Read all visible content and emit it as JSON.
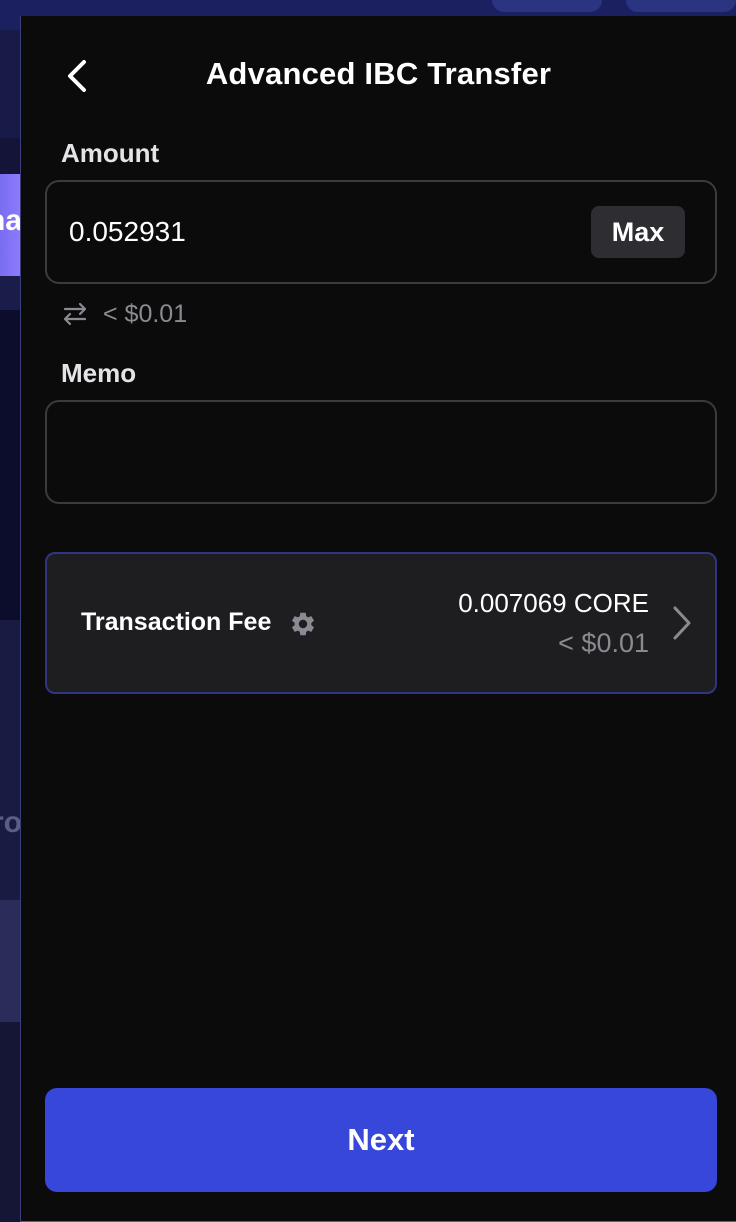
{
  "header": {
    "title": "Advanced IBC Transfer"
  },
  "amount": {
    "label": "Amount",
    "value": "0.052931",
    "max_label": "Max",
    "fiat_conversion": "< $0.01"
  },
  "memo": {
    "label": "Memo",
    "value": "",
    "placeholder": ""
  },
  "fee": {
    "label": "Transaction Fee",
    "amount": "0.007069 CORE",
    "fiat": "< $0.01"
  },
  "footer": {
    "next_label": "Next"
  },
  "background": {
    "partial_text_1": "na",
    "partial_text_2": "ro"
  },
  "colors": {
    "accent": "#3747d9",
    "panel": "#0b0b0c",
    "card": "#1e1e20",
    "muted_text": "#8a8a92"
  },
  "icons": [
    "chevron-left-icon",
    "swap-arrows-icon",
    "gear-icon",
    "chevron-right-icon"
  ]
}
